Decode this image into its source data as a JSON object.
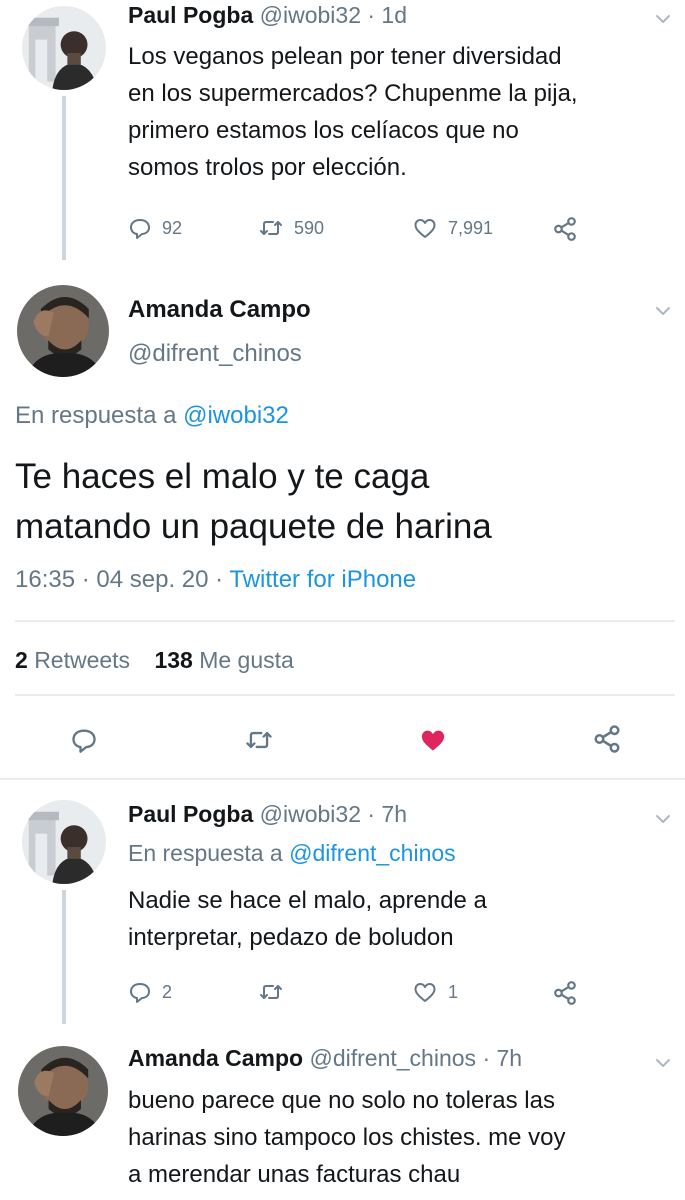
{
  "tweet1": {
    "name": "Paul Pogba",
    "handle": "@iwobi32",
    "time": "· 1d",
    "lines": [
      "Los veganos pelean por tener diversidad",
      "en los supermercados? Chupenme la pija,",
      "primero estamos los celíacos que no",
      "somos trolos por elección."
    ],
    "replies": "92",
    "retweets": "590",
    "likes": "7,991",
    "avatar_icon": "avatar-arc-man-icon"
  },
  "main": {
    "name": "Amanda Campo",
    "handle": "@difrent_chinos",
    "reply_prefix": "En respuesta a",
    "reply_to": "@iwobi32",
    "lines": [
      "Te haces el malo y te caga",
      "matando un paquete de harina"
    ],
    "timestamp": "16:35 · 04 sep. 20 ·",
    "source": "Twitter for iPhone",
    "retweet_count": "2",
    "retweet_label": "Retweets",
    "like_count": "138",
    "like_label": "Me gusta",
    "liked_color": "#e0245e"
  },
  "tweet3": {
    "name": "Paul Pogba",
    "handle": "@iwobi32",
    "time": "· 7h",
    "reply_prefix": "En respuesta a",
    "reply_to": "@difrent_chinos",
    "lines": [
      "Nadie se hace el malo, aprende a",
      "interpretar, pedazo de boludon"
    ],
    "replies": "2",
    "likes": "1"
  },
  "tweet4": {
    "name": "Amanda Campo",
    "handle": "@difrent_chinos",
    "time": "· 7h",
    "lines": [
      "bueno parece que no solo no toleras las",
      "harinas sino tampoco los chistes. me voy",
      "a merendar unas facturas chau"
    ]
  }
}
